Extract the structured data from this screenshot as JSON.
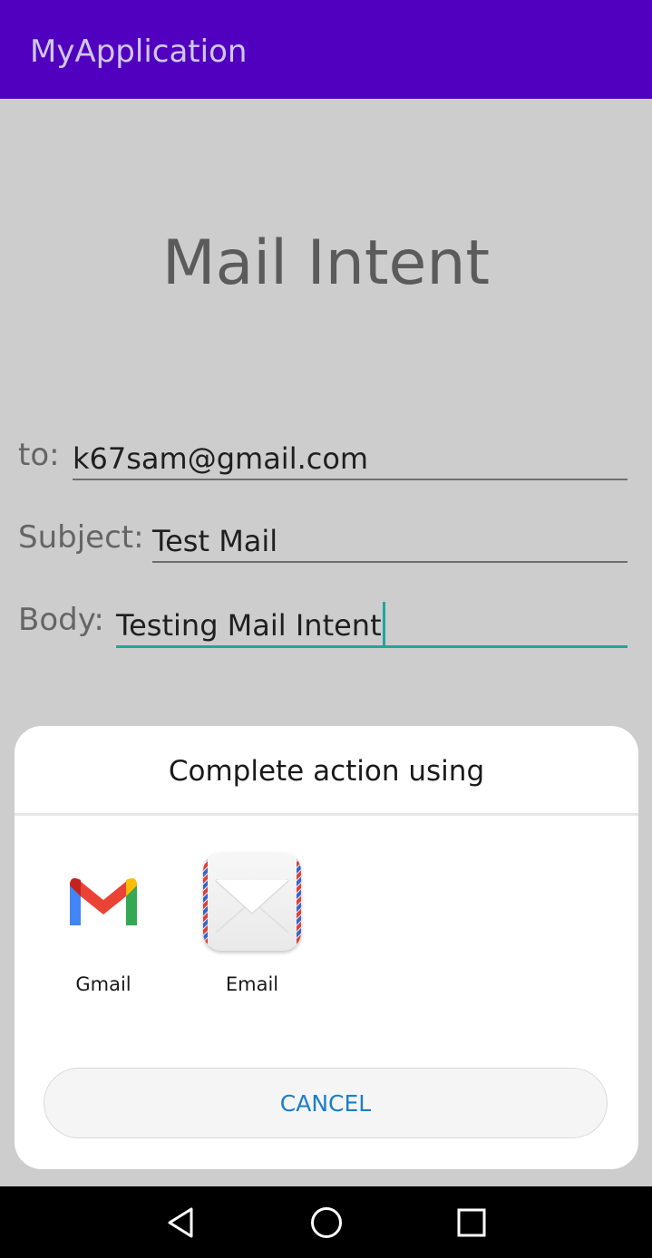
{
  "app_bar": {
    "title": "MyApplication"
  },
  "main": {
    "heading": "Mail Intent",
    "fields": {
      "to": {
        "label": "to:",
        "value": "k67sam@gmail.com"
      },
      "subject": {
        "label": "Subject:",
        "value": "Test Mail"
      },
      "body": {
        "label": "Body:",
        "value": "Testing Mail Intent"
      }
    }
  },
  "dialog": {
    "title": "Complete action using",
    "apps": [
      {
        "label": "Gmail",
        "icon": "gmail-icon"
      },
      {
        "label": "Email",
        "icon": "email-icon"
      }
    ],
    "cancel_label": "CANCEL"
  },
  "nav_bar": {
    "buttons": [
      "back-icon",
      "home-icon",
      "recents-icon"
    ]
  },
  "colors": {
    "app_bar": "#5200bf",
    "accent": "#1fa79c",
    "cancel_text": "#1a7fc9"
  }
}
